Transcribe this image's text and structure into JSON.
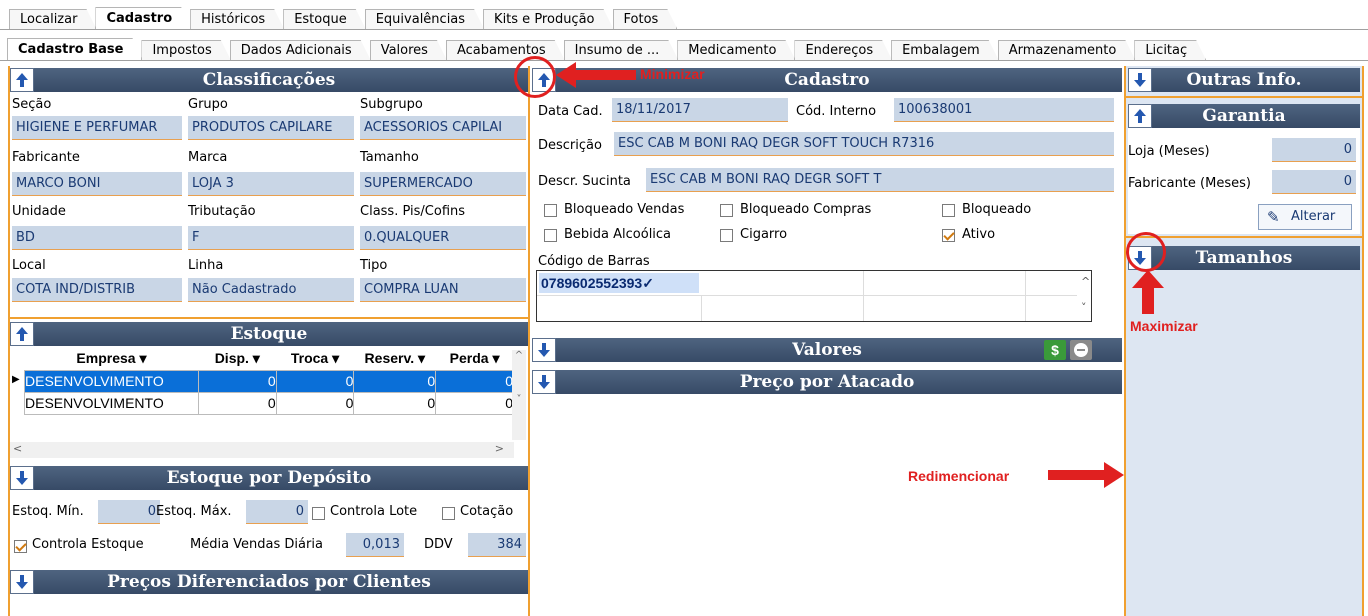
{
  "top_tabs": [
    "Localizar",
    "Cadastro",
    "Históricos",
    "Estoque",
    "Equivalências",
    "Kits e Produção",
    "Fotos"
  ],
  "sub_tabs": [
    "Cadastro Base",
    "Impostos",
    "Dados Adicionais",
    "Valores",
    "Acabamentos",
    "Insumo de ...",
    "Medicamento",
    "Endereços",
    "Embalagem",
    "Armazenamento",
    "Licitaç"
  ],
  "classificacoes": {
    "title": "Classificações",
    "secao_label": "Seção",
    "secao": "HIGIENE E PERFUMAR",
    "grupo_label": "Grupo",
    "grupo": "PRODUTOS CAPILARE",
    "subgrupo_label": "Subgrupo",
    "subgrupo": "ACESSORIOS CAPILAI",
    "fabricante_label": "Fabricante",
    "fabricante": "MARCO BONI",
    "marca_label": "Marca",
    "marca": "LOJA 3",
    "tamanho_label": "Tamanho",
    "tamanho": "SUPERMERCADO",
    "unidade_label": "Unidade",
    "unidade": "BD",
    "tributacao_label": "Tributação",
    "tributacao": "F",
    "pis_label": "Class. Pis/Cofins",
    "pis": "0.QUALQUER",
    "local_label": "Local",
    "local": "COTA IND/DISTRIB",
    "linha_label": "Linha",
    "linha": "Não Cadastrado",
    "tipo_label": "Tipo",
    "tipo": "COMPRA LUAN"
  },
  "estoque": {
    "title": "Estoque",
    "columns": [
      "Empresa",
      "Disp.",
      "Troca",
      "Reserv.",
      "Perda"
    ],
    "rows": [
      [
        "DESENVOLVIMENTO",
        "0",
        "0",
        "0",
        "0"
      ],
      [
        "DESENVOLVIMENTO",
        "0",
        "0",
        "0",
        "0"
      ]
    ]
  },
  "estoque_deposito": {
    "title": "Estoque por Depósito",
    "min_label": "Estoq. Mín.",
    "min": "0",
    "max_label": "Estoq. Máx.",
    "max": "0",
    "controla_lote": "Controla Lote",
    "cotacao": "Cotação",
    "controla_estoque": "Controla Estoque",
    "media_label": "Média Vendas Diária",
    "media": "0,013",
    "ddv_label": "DDV",
    "ddv": "384"
  },
  "precos_clientes": {
    "title": "Preços Diferenciados por Clientes"
  },
  "cadastro": {
    "title": "Cadastro",
    "data_label": "Data Cad.",
    "data": "18/11/2017",
    "cod_label": "Cód. Interno",
    "cod": "100638001",
    "desc_label": "Descrição",
    "desc": "ESC CAB M BONI RAQ DEGR SOFT TOUCH R7316",
    "sucinta_label": "Descr. Sucinta",
    "sucinta": "ESC CAB M BONI RAQ DEGR SOFT T",
    "bloq_vendas": "Bloqueado Vendas",
    "bloq_compras": "Bloqueado Compras",
    "bloqueado": "Bloqueado",
    "bebida": "Bebida Alcoólica",
    "cigarro": "Cigarro",
    "ativo": "Ativo",
    "barras_label": "Código de Barras",
    "barras": "0789602552393"
  },
  "valores": {
    "title": "Valores",
    "currency_icon": "$"
  },
  "atacado": {
    "title": "Preço por Atacado"
  },
  "outras": {
    "title": "Outras Info."
  },
  "garantia": {
    "title": "Garantia",
    "loja_label": "Loja (Meses)",
    "loja": "0",
    "fab_label": "Fabricante (Meses)",
    "fab": "0",
    "alterar": "Alterar"
  },
  "tamanhos": {
    "title": "Tamanhos"
  },
  "annotations": {
    "minimizar": "Minimizar",
    "maximizar": "Maximizar",
    "redimencionar": "Redimencionar"
  },
  "colors": {
    "header": "#3f536f",
    "border": "#f0a030",
    "field": "#c9d6e6",
    "selected": "#0a6fd8",
    "annotation": "#e02020"
  }
}
